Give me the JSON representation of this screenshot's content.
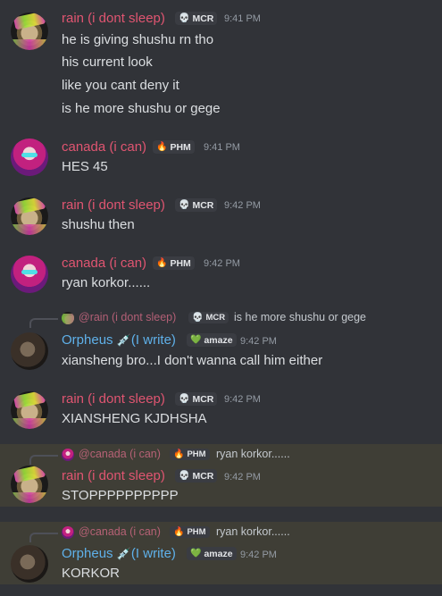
{
  "users": {
    "rain": {
      "name": "rain (i dont sleep)",
      "tag": "MCR",
      "tag_icon": "skull-icon"
    },
    "canada": {
      "name": "canada (i can)",
      "tag": "PHM",
      "tag_icon": "flame-icon"
    },
    "orpheus": {
      "name": "Orpheus",
      "name_suffix": "(I write)",
      "name_emoji": "syringes-icon",
      "tag": "amaze",
      "tag_icon": "heart-icon"
    }
  },
  "messages": [
    {
      "author": "rain (i dont sleep)",
      "tag": "MCR",
      "time": "9:41 PM",
      "lines": [
        "he is giving shushu rn tho",
        "his current look",
        "like you cant deny it",
        "is he more shushu or gege"
      ]
    },
    {
      "author": "canada (i can)",
      "tag": "PHM",
      "time": "9:41 PM",
      "lines": [
        "HES 45"
      ]
    },
    {
      "author": "rain (i dont sleep)",
      "tag": "MCR",
      "time": "9:42 PM",
      "lines": [
        "shushu then"
      ]
    },
    {
      "author": "canada (i can)",
      "tag": "PHM",
      "time": "9:42 PM",
      "lines": [
        "ryan korkor......"
      ]
    },
    {
      "reply": {
        "name": "@rain (i dont sleep)",
        "tag": "MCR",
        "text": "is he more shushu or gege"
      },
      "author": "Orpheus",
      "author_suffix": "(I write)",
      "tag": "amaze",
      "time": "9:42 PM",
      "lines": [
        "xiansheng bro...I don't wanna call him either"
      ]
    },
    {
      "author": "rain (i dont sleep)",
      "tag": "MCR",
      "time": "9:42 PM",
      "lines": [
        "XIANSHENG KJDHSHA"
      ]
    },
    {
      "reply": {
        "name": "@canada (i can)",
        "tag": "PHM",
        "text": "ryan korkor......"
      },
      "author": "rain (i dont sleep)",
      "tag": "MCR",
      "time": "9:42 PM",
      "lines": [
        "STOPPPPPPPPPP"
      ]
    },
    {
      "reply": {
        "name": "@canada (i can)",
        "tag": "PHM",
        "text": "ryan korkor......"
      },
      "author": "Orpheus",
      "author_suffix": "(I write)",
      "tag": "amaze",
      "time": "9:42 PM",
      "lines": [
        "KORKOR"
      ]
    }
  ],
  "colors": {
    "background": "#313338",
    "highlight": "#3f3e36",
    "rain_name": "#e05571",
    "orpheus_name": "#5fb1ea",
    "timestamp": "#949ba4",
    "text": "#dbdee1"
  }
}
